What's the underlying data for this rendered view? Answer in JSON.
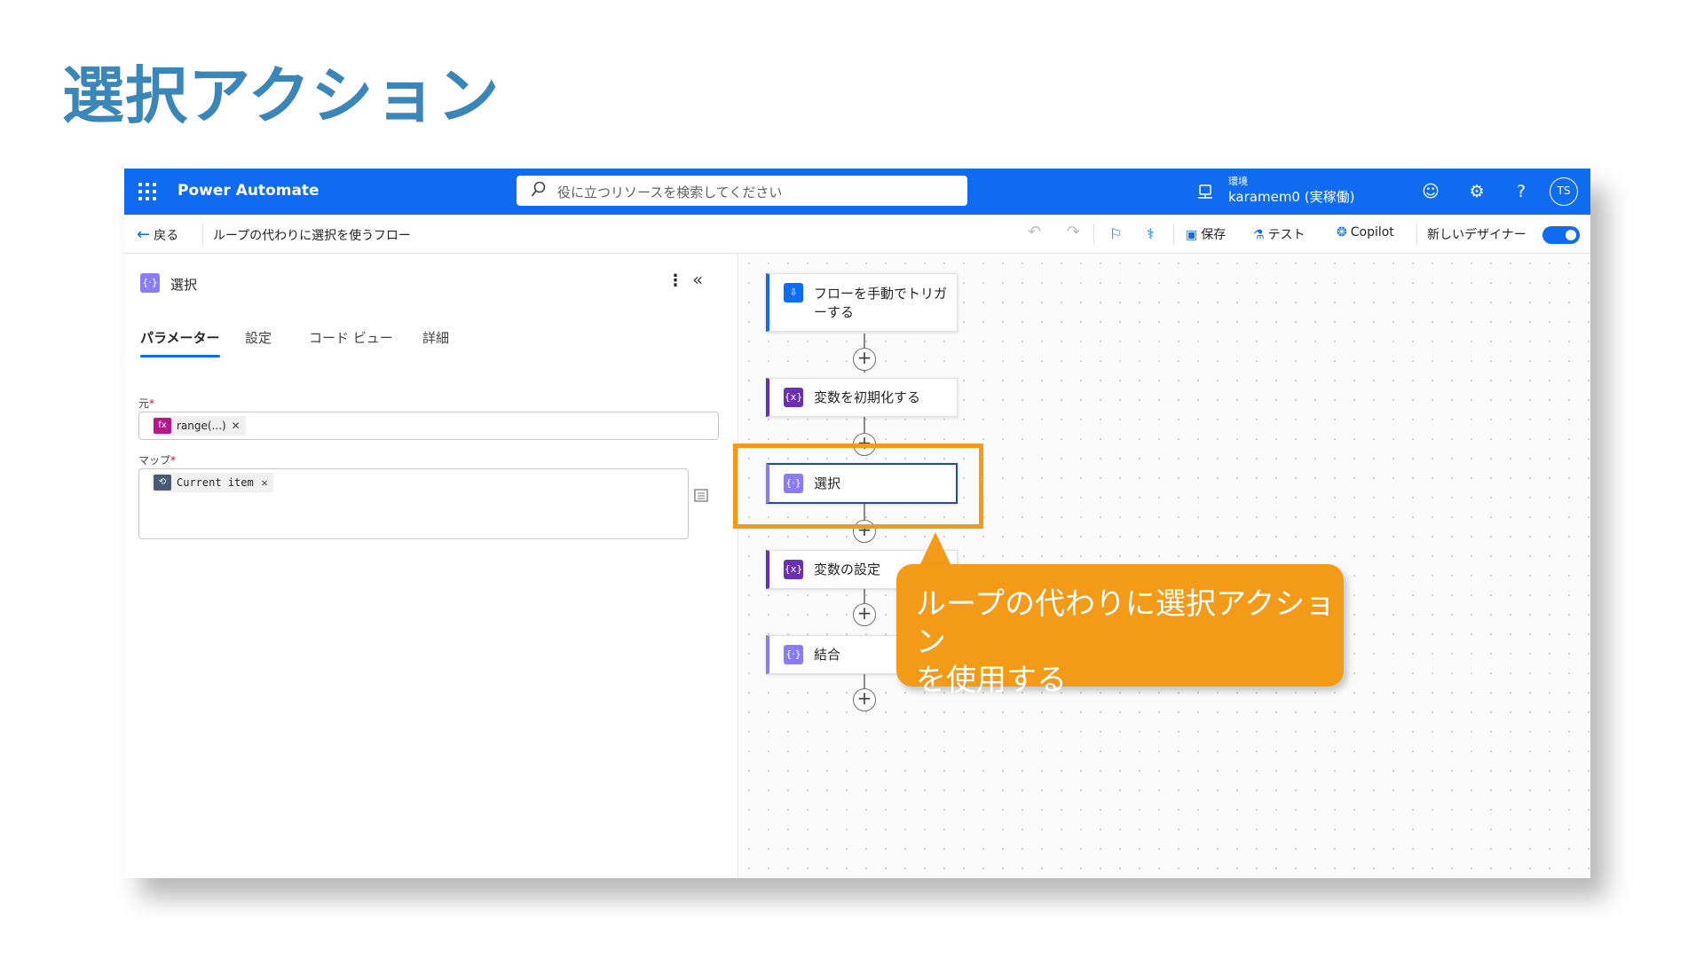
{
  "slide": {
    "title": "選択アクション"
  },
  "topbar": {
    "app_name": "Power Automate",
    "search_placeholder": "役に立つリソースを検索してください",
    "env_label": "環境",
    "env_name": "karamem0 (実稼働)",
    "avatar_initials": "TS"
  },
  "cmdbar": {
    "back_label": "戻る",
    "flow_name": "ループの代わりに選択を使うフロー",
    "save_label": "保存",
    "test_label": "テスト",
    "copilot_label": "Copilot",
    "new_designer_label": "新しいデザイナー",
    "new_designer_on": true
  },
  "panel": {
    "title": "選択",
    "tabs": [
      {
        "label": "パラメーター",
        "active": true
      },
      {
        "label": "設定",
        "active": false
      },
      {
        "label": "コード ビュー",
        "active": false
      },
      {
        "label": "詳細",
        "active": false
      }
    ],
    "from_label": "元",
    "from_token": "range(...)",
    "map_label": "マップ",
    "map_token": "Current item",
    "required_mark": "*"
  },
  "canvas": {
    "cards": [
      {
        "label_line1": "フローを手動でトリガ",
        "label_line2": "ーする",
        "icon": "trigger-icon"
      },
      {
        "label": "変数を初期化する",
        "icon": "variable-icon"
      },
      {
        "label": "選択",
        "icon": "select-icon",
        "selected": true
      },
      {
        "label": "変数の設定",
        "icon": "variable-icon"
      },
      {
        "label": "結合",
        "icon": "join-icon"
      }
    ]
  },
  "annotation": {
    "callout_line1": "ループの代わりに選択アクション",
    "callout_line2": "を使用する"
  },
  "colors": {
    "brand_blue": "#0f6cf0",
    "accent_orange": "#f39b19",
    "title_blue": "#3a86b8",
    "variable_purple": "#6b2fb3",
    "select_purple": "#8b7cf6"
  }
}
